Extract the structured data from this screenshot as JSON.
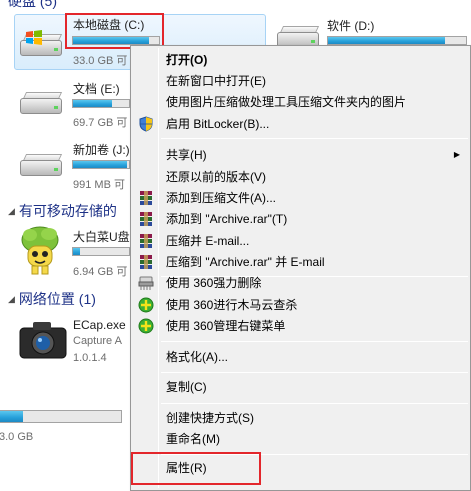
{
  "explorer": {
    "hard_drives_header": "硬盘 (5)",
    "removable_header": "有可移动存储的",
    "network_header": "网络位置 (1)",
    "drives": [
      {
        "name": "本地磁盘 (C:)",
        "free": "33.0 GB 可",
        "usage": 0.88
      },
      {
        "name": "软件 (D:)",
        "free": "",
        "usage": 0.85
      },
      {
        "name": "文档 (E:)",
        "free": "69.7 GB 可",
        "usage": 0.45
      },
      {
        "name": "新加卷 (J:)",
        "free": "991 MB 可",
        "usage": 0.97
      }
    ],
    "removable": {
      "name": "大白菜U盘",
      "free": "6.94 GB 可",
      "usage": 0.12
    },
    "network_item": {
      "name": "ECap.exe",
      "line2": "Capture A",
      "line3": "1.0.1.4"
    },
    "bottom_drive": {
      "free": "3.0 GB",
      "usage": 0.1
    }
  },
  "context_menu": {
    "items": [
      {
        "label": "打开(O)",
        "bold": true
      },
      {
        "label": "在新窗口中打开(E)"
      },
      {
        "label": "使用图片压缩做处理工具压缩文件夹内的图片"
      },
      {
        "label": "启用 BitLocker(B)...",
        "icon": "shield-icon"
      },
      {
        "label": "共享(H)",
        "submenu": true
      },
      {
        "label": "还原以前的版本(V)"
      },
      {
        "label": "添加到压缩文件(A)...",
        "icon": "winrar-icon"
      },
      {
        "label": "添加到 \"Archive.rar\"(T)",
        "icon": "winrar-icon"
      },
      {
        "label": "压缩并 E-mail...",
        "icon": "winrar-icon"
      },
      {
        "label": "压缩到 \"Archive.rar\" 并 E-mail",
        "icon": "winrar-icon"
      },
      {
        "label": "使用 360强力删除",
        "icon": "shredder-icon"
      },
      {
        "label": "使用 360进行木马云查杀",
        "icon": "360-icon"
      },
      {
        "label": "使用 360管理右键菜单",
        "icon": "360-icon"
      },
      {
        "label": "格式化(A)..."
      },
      {
        "label": "复制(C)"
      },
      {
        "label": "创建快捷方式(S)"
      },
      {
        "label": "重命名(M)"
      },
      {
        "label": "属性(R)"
      }
    ]
  },
  "colors": {
    "highlight_red": "#e3262b",
    "progress_blue": "#26a0da",
    "menu_bg": "#f0f0f0",
    "header_blue": "#1e3287"
  }
}
